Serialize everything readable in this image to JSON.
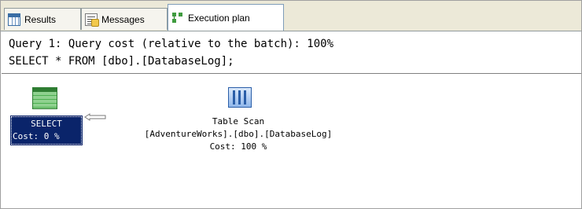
{
  "tabs": [
    {
      "label": "Results",
      "icon": "results-grid-icon"
    },
    {
      "label": "Messages",
      "icon": "messages-icon"
    },
    {
      "label": "Execution plan",
      "icon": "execution-plan-icon",
      "active": true
    }
  ],
  "query": {
    "line1": "Query 1: Query cost (relative to the batch): 100%",
    "line2": "SELECT * FROM [dbo].[DatabaseLog];"
  },
  "plan": {
    "select_node": {
      "title": "SELECT",
      "cost": "Cost: 0 %",
      "icon": "select-operator-icon"
    },
    "scan_node": {
      "title": "Table Scan",
      "object": "[AdventureWorks].[dbo].[DatabaseLog]",
      "cost": "Cost: 100 %",
      "icon": "table-scan-icon"
    }
  },
  "colors": {
    "selected_node_bg": "#0a246a",
    "tabstrip_bg": "#ece9d8"
  }
}
